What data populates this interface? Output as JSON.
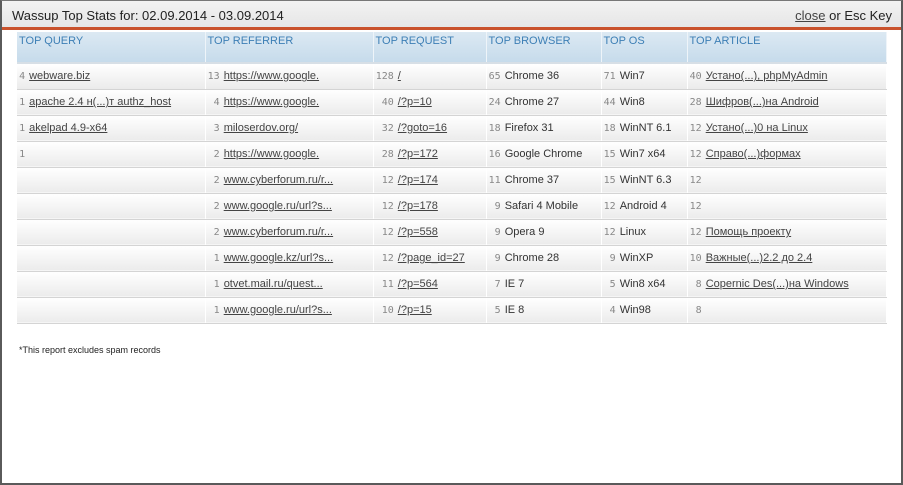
{
  "window": {
    "title": "Wassup Top Stats for: 02.09.2014 - 03.09.2014",
    "close_label": "close",
    "close_suffix": " or Esc Key",
    "accent": "#c9522c"
  },
  "columns": [
    {
      "header": "TOP QUERY",
      "items": [
        {
          "count": "4",
          "text": "webware.biz",
          "link": true
        },
        {
          "count": "1",
          "text": "apache 2.4 н(...)т authz_host",
          "link": true
        },
        {
          "count": "1",
          "text": "akelpad 4.9-x64",
          "link": true
        },
        {
          "count": "1",
          "text": "",
          "link": false
        },
        {
          "count": "",
          "text": "",
          "link": false
        },
        {
          "count": "",
          "text": "",
          "link": false
        },
        {
          "count": "",
          "text": "",
          "link": false
        },
        {
          "count": "",
          "text": "",
          "link": false
        },
        {
          "count": "",
          "text": "",
          "link": false
        },
        {
          "count": "",
          "text": "",
          "link": false
        }
      ]
    },
    {
      "header": "TOP REFERRER",
      "items": [
        {
          "count": "13",
          "text": "https://www.google.",
          "link": true
        },
        {
          "count": "4",
          "text": "https://www.google.",
          "link": true
        },
        {
          "count": "3",
          "text": "miloserdov.org/",
          "link": true
        },
        {
          "count": "2",
          "text": "https://www.google.",
          "link": true
        },
        {
          "count": "2",
          "text": "www.cyberforum.ru/r...",
          "link": true
        },
        {
          "count": "2",
          "text": "www.google.ru/url?s...",
          "link": true
        },
        {
          "count": "2",
          "text": "www.cyberforum.ru/r...",
          "link": true
        },
        {
          "count": "1",
          "text": "www.google.kz/url?s...",
          "link": true
        },
        {
          "count": "1",
          "text": "otvet.mail.ru/quest...",
          "link": true
        },
        {
          "count": "1",
          "text": "www.google.ru/url?s...",
          "link": true
        }
      ]
    },
    {
      "header": "TOP REQUEST",
      "items": [
        {
          "count": "128",
          "text": "/",
          "link": true
        },
        {
          "count": "40",
          "text": "/?p=10",
          "link": true
        },
        {
          "count": "32",
          "text": "/?goto=16",
          "link": true
        },
        {
          "count": "28",
          "text": "/?p=172",
          "link": true
        },
        {
          "count": "12",
          "text": "/?p=174",
          "link": true
        },
        {
          "count": "12",
          "text": "/?p=178",
          "link": true
        },
        {
          "count": "12",
          "text": "/?p=558",
          "link": true
        },
        {
          "count": "12",
          "text": "/?page_id=27",
          "link": true
        },
        {
          "count": "11",
          "text": "/?p=564",
          "link": true
        },
        {
          "count": "10",
          "text": "/?p=15",
          "link": true
        }
      ]
    },
    {
      "header": "TOP BROWSER",
      "items": [
        {
          "count": "65",
          "text": "Chrome 36",
          "link": false
        },
        {
          "count": "24",
          "text": "Chrome 27",
          "link": false
        },
        {
          "count": "18",
          "text": "Firefox 31",
          "link": false
        },
        {
          "count": "16",
          "text": "Google Chrome",
          "link": false
        },
        {
          "count": "11",
          "text": "Chrome 37",
          "link": false
        },
        {
          "count": "9",
          "text": "Safari 4 Mobile",
          "link": false
        },
        {
          "count": "9",
          "text": "Opera 9",
          "link": false
        },
        {
          "count": "9",
          "text": "Chrome 28",
          "link": false
        },
        {
          "count": "7",
          "text": "IE 7",
          "link": false
        },
        {
          "count": "5",
          "text": "IE 8",
          "link": false
        }
      ]
    },
    {
      "header": "TOP OS",
      "items": [
        {
          "count": "71",
          "text": "Win7",
          "link": false
        },
        {
          "count": "44",
          "text": "Win8",
          "link": false
        },
        {
          "count": "18",
          "text": "WinNT 6.1",
          "link": false
        },
        {
          "count": "15",
          "text": "Win7 x64",
          "link": false
        },
        {
          "count": "15",
          "text": "WinNT 6.3",
          "link": false
        },
        {
          "count": "12",
          "text": "Android 4",
          "link": false
        },
        {
          "count": "12",
          "text": "Linux",
          "link": false
        },
        {
          "count": "9",
          "text": "WinXP",
          "link": false
        },
        {
          "count": "5",
          "text": "Win8 x64",
          "link": false
        },
        {
          "count": "4",
          "text": "Win98",
          "link": false
        }
      ]
    },
    {
      "header": "TOP ARTICLE",
      "items": [
        {
          "count": "40",
          "text": "Устано(...), phpMyAdmin",
          "link": true
        },
        {
          "count": "28",
          "text": "Шифров(...)на Android",
          "link": true
        },
        {
          "count": "12",
          "text": "Устано(...)0 на Linux",
          "link": true
        },
        {
          "count": "12",
          "text": "Справо(...)формах",
          "link": true
        },
        {
          "count": "12",
          "text": "",
          "link": false
        },
        {
          "count": "12",
          "text": "",
          "link": false
        },
        {
          "count": "12",
          "text": "Помощь проекту",
          "link": true
        },
        {
          "count": "10",
          "text": "Важные(...)2.2 до 2.4",
          "link": true
        },
        {
          "count": "8",
          "text": "Copernic Des(...)на Windows",
          "link": true
        },
        {
          "count": "8",
          "text": "",
          "link": false
        }
      ]
    }
  ],
  "footer_note": "*This report excludes spam records"
}
